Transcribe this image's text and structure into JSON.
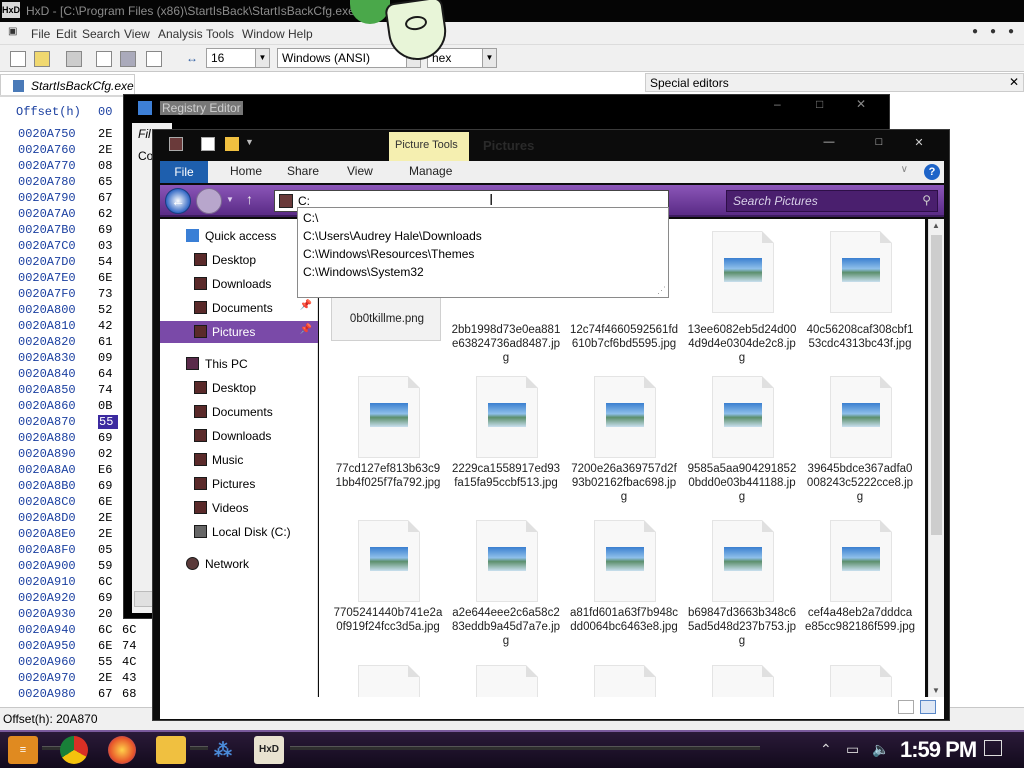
{
  "hxd": {
    "title": "HxD - [C:\\Program Files (x86)\\StartIsBack\\StartIsBackCfg.exe",
    "icon_label": "HxD",
    "menu": [
      "File",
      "Edit",
      "Search",
      "View",
      "Analysis",
      "Tools",
      "Window",
      "Help"
    ],
    "toolbar": {
      "bytes_per_row": "16",
      "charset": "Windows (ANSI)",
      "display": "hex"
    },
    "tab": "StartIsBackCfg.exe",
    "special_editors": "Special editors",
    "offset_header": "Offset(h)",
    "col_header": "00",
    "rows": [
      {
        "o": "0020A750",
        "b": [
          "2E"
        ]
      },
      {
        "o": "0020A760",
        "b": [
          "2E"
        ]
      },
      {
        "o": "0020A770",
        "b": [
          "08"
        ]
      },
      {
        "o": "0020A780",
        "b": [
          "65"
        ]
      },
      {
        "o": "0020A790",
        "b": [
          "67"
        ]
      },
      {
        "o": "0020A7A0",
        "b": [
          "62"
        ]
      },
      {
        "o": "0020A7B0",
        "b": [
          "69"
        ]
      },
      {
        "o": "0020A7C0",
        "b": [
          "03"
        ]
      },
      {
        "o": "0020A7D0",
        "b": [
          "54"
        ]
      },
      {
        "o": "0020A7E0",
        "b": [
          "6E"
        ]
      },
      {
        "o": "0020A7F0",
        "b": [
          "73"
        ]
      },
      {
        "o": "0020A800",
        "b": [
          "52"
        ]
      },
      {
        "o": "0020A810",
        "b": [
          "42"
        ]
      },
      {
        "o": "0020A820",
        "b": [
          "61"
        ]
      },
      {
        "o": "0020A830",
        "b": [
          "09"
        ]
      },
      {
        "o": "0020A840",
        "b": [
          "64"
        ]
      },
      {
        "o": "0020A850",
        "b": [
          "74"
        ]
      },
      {
        "o": "0020A860",
        "b": [
          "0B"
        ]
      },
      {
        "o": "0020A870",
        "b": [
          "55"
        ]
      },
      {
        "o": "0020A880",
        "b": [
          "69"
        ]
      },
      {
        "o": "0020A890",
        "b": [
          "02"
        ]
      },
      {
        "o": "0020A8A0",
        "b": [
          "E6"
        ]
      },
      {
        "o": "0020A8B0",
        "b": [
          "69"
        ]
      },
      {
        "o": "0020A8C0",
        "b": [
          "6E"
        ]
      },
      {
        "o": "0020A8D0",
        "b": [
          "2E"
        ]
      },
      {
        "o": "0020A8E0",
        "b": [
          "2E"
        ]
      },
      {
        "o": "0020A8F0",
        "b": [
          "05"
        ]
      },
      {
        "o": "0020A900",
        "b": [
          "59"
        ]
      },
      {
        "o": "0020A910",
        "b": [
          "6C"
        ]
      },
      {
        "o": "0020A920",
        "b": [
          "69"
        ]
      },
      {
        "o": "0020A930",
        "b": [
          "20"
        ]
      },
      {
        "o": "0020A940",
        "b": [
          "6C",
          "6C"
        ]
      },
      {
        "o": "0020A950",
        "b": [
          "6E",
          "74"
        ]
      },
      {
        "o": "0020A960",
        "b": [
          "55",
          "4C"
        ]
      },
      {
        "o": "0020A970",
        "b": [
          "2E",
          "43"
        ]
      },
      {
        "o": "0020A980",
        "b": [
          "67",
          "68"
        ]
      }
    ],
    "status_offset": "Offset(h): 20A870"
  },
  "regedit": {
    "title": "Registry Editor",
    "menu_fragment": "Fil",
    "tree_fragment": "Co"
  },
  "explorer": {
    "picture_tools": "Picture Tools",
    "window_title": "Pictures",
    "ribbon_tabs": [
      "File",
      "Home",
      "Share",
      "View",
      "Manage"
    ],
    "address_value": "C:",
    "search_placeholder": "Search Pictures",
    "suggestions": [
      "C:\\",
      "C:\\Users\\Audrey Hale\\Downloads",
      "C:\\Windows\\Resources\\Themes",
      "C:\\Windows\\System32"
    ],
    "nav": {
      "quick_access": "Quick access",
      "qa_items": [
        "Desktop",
        "Downloads",
        "Documents",
        "Pictures"
      ],
      "this_pc": "This PC",
      "pc_items": [
        "Desktop",
        "Documents",
        "Downloads",
        "Music",
        "Pictures",
        "Videos",
        "Local Disk (C:)"
      ],
      "network": "Network"
    },
    "files": [
      "0b0tkillme.png",
      "2bb1998d73e0ea881e63824736ad8487.jpg",
      "12c74f4660592561fd610b7cf6bd5595.jpg",
      "13ee6082eb5d24d004d9d4e0304de2c8.jpg",
      "40c56208caf308cbf153cdc4313bc43f.jpg",
      "77cd127ef813b63c91bb4f025f7fa792.jpg",
      "2229ca1558917ed93fa15fa95ccbf513.jpg",
      "7200e26a369757d2f93b02162fbac698.jpg",
      "9585a5aa9042918520bdd0e03b441188.jpg",
      "39645bdce367adfa0008243c5222cce8.jpg",
      "7705241440b741e2a0f919f24fcc3d5a.jpg",
      "a2e644eee2c6a58c283eddb9a45d7a7e.jpg",
      "a81fd601a63f7b948cdd0064bc6463e8.jpg",
      "b69847d3663b348c65ad5d48d237b753.jpg",
      "cef4a48eb2a7dddcae85cc982186f599.jpg"
    ]
  },
  "taskbar": {
    "clock": "1:59 PM",
    "hxd_label": "HxD"
  }
}
